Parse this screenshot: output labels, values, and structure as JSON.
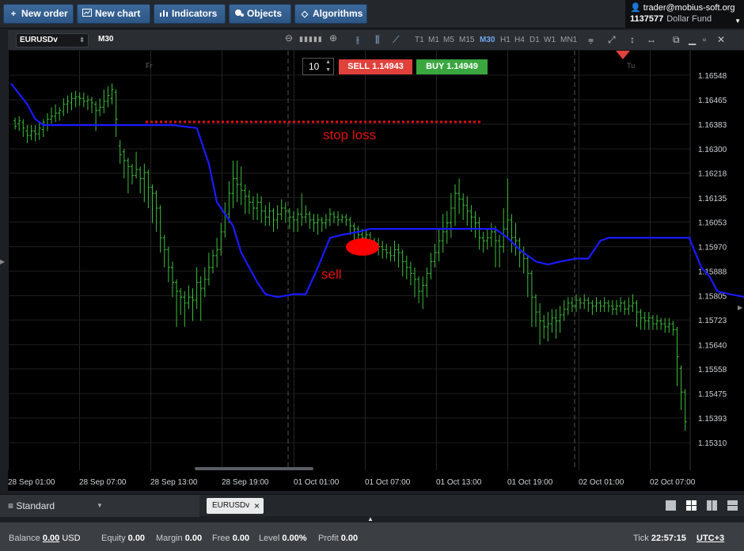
{
  "toolbar": {
    "buttons": [
      {
        "icon": "plus-icon",
        "label": "New order"
      },
      {
        "icon": "chart-icon",
        "label": "New chart"
      },
      {
        "icon": "bar-chart-icon",
        "label": "Indicators"
      },
      {
        "icon": "objects-icon",
        "label": "Objects"
      },
      {
        "icon": "diamond-icon",
        "label": "Algorithms"
      }
    ]
  },
  "account": {
    "user": "trader@mobius-soft.org",
    "number": "1137577",
    "fund": "Dollar Fund"
  },
  "chart_header": {
    "symbol": "EURUSDv",
    "timeframe": "M30",
    "timeframes": [
      "T1",
      "M1",
      "M5",
      "M15",
      "M30",
      "H1",
      "H4",
      "D1",
      "W1",
      "MN1"
    ],
    "active_timeframe": "M30"
  },
  "trade": {
    "quantity": "10",
    "sell_label": "SELL 1.14943",
    "buy_label": "BUY 1.14949",
    "sell_color": "#e0413b",
    "buy_color": "#3aa63f"
  },
  "chart_data": {
    "type": "candlestick",
    "price_axis": [
      "1.16548",
      "1.16465",
      "1.16383",
      "1.16300",
      "1.16218",
      "1.16135",
      "1.16053",
      "1.15970",
      "1.15888",
      "1.15805",
      "1.15723",
      "1.15640",
      "1.15558",
      "1.15475",
      "1.15393",
      "1.15310"
    ],
    "time_axis": [
      "28 Sep 01:00",
      "28 Sep 07:00",
      "28 Sep 13:00",
      "28 Sep 19:00",
      "01 Oct 01:00",
      "01 Oct 07:00",
      "01 Oct 13:00",
      "01 Oct 19:00",
      "02 Oct 01:00",
      "02 Oct 07:00"
    ],
    "session_labels": [
      "Fr",
      "Tu"
    ],
    "candle_color": "#3cbf3c",
    "indicator_color": "#1a1aff",
    "indicator_line": [
      [
        0,
        1.1652
      ],
      [
        4,
        1.1645
      ],
      [
        6,
        1.164
      ],
      [
        8,
        1.1638
      ],
      [
        10,
        1.1638
      ],
      [
        24,
        1.1638
      ],
      [
        40,
        1.1638
      ],
      [
        46,
        1.1637
      ],
      [
        49,
        1.1625
      ],
      [
        51,
        1.1612
      ],
      [
        53,
        1.1608
      ],
      [
        55,
        1.1604
      ],
      [
        57,
        1.1595
      ],
      [
        59,
        1.159
      ],
      [
        61,
        1.1585
      ],
      [
        63,
        1.1581
      ],
      [
        66,
        1.158
      ],
      [
        70,
        1.1581
      ],
      [
        73,
        1.1581
      ],
      [
        76,
        1.159
      ],
      [
        79,
        1.16
      ],
      [
        82,
        1.1601
      ],
      [
        86,
        1.1602
      ],
      [
        89,
        1.1603
      ],
      [
        96,
        1.1603
      ],
      [
        103,
        1.1603
      ],
      [
        120,
        1.1603
      ],
      [
        123,
        1.16
      ],
      [
        126,
        1.1596
      ],
      [
        130,
        1.1592
      ],
      [
        133,
        1.1591
      ],
      [
        136,
        1.1592
      ],
      [
        140,
        1.1593
      ],
      [
        143,
        1.1593
      ],
      [
        146,
        1.1599
      ],
      [
        148,
        1.16
      ],
      [
        154,
        1.16
      ],
      [
        168,
        1.16
      ],
      [
        171,
        1.159
      ],
      [
        173,
        1.1587
      ],
      [
        175,
        1.1582
      ],
      [
        178,
        1.1581
      ],
      [
        182,
        1.158
      ],
      [
        204,
        1.158
      ],
      [
        212,
        1.158
      ],
      [
        216,
        1.1572
      ],
      [
        218,
        1.1564
      ]
    ],
    "candles": [
      [
        1,
        1.16395,
        1.16375,
        1.16405,
        1.16365
      ],
      [
        2,
        1.16385,
        1.16395,
        1.1641,
        1.1636
      ],
      [
        3,
        1.1639,
        1.1637,
        1.164,
        1.1634
      ],
      [
        4,
        1.1636,
        1.16345,
        1.1638,
        1.1632
      ],
      [
        5,
        1.16345,
        1.1636,
        1.1638,
        1.1633
      ],
      [
        6,
        1.1636,
        1.1635,
        1.1638,
        1.16325
      ],
      [
        7,
        1.1635,
        1.1637,
        1.1639,
        1.1633
      ],
      [
        8,
        1.16365,
        1.1639,
        1.164,
        1.1634
      ],
      [
        9,
        1.1638,
        1.164,
        1.1642,
        1.1636
      ],
      [
        10,
        1.164,
        1.1641,
        1.1644,
        1.16385
      ],
      [
        11,
        1.1641,
        1.1642,
        1.1645,
        1.1639
      ],
      [
        12,
        1.1642,
        1.1643,
        1.1644,
        1.16395
      ],
      [
        13,
        1.16425,
        1.1645,
        1.1647,
        1.1641
      ],
      [
        14,
        1.1645,
        1.1646,
        1.1648,
        1.1642
      ],
      [
        15,
        1.16455,
        1.1647,
        1.1649,
        1.1643
      ],
      [
        16,
        1.1647,
        1.16475,
        1.16495,
        1.1644
      ],
      [
        17,
        1.16475,
        1.1647,
        1.1649,
        1.16445
      ],
      [
        18,
        1.1647,
        1.1646,
        1.1649,
        1.1644
      ],
      [
        19,
        1.1646,
        1.16465,
        1.1648,
        1.1643
      ],
      [
        20,
        1.16465,
        1.16455,
        1.16475,
        1.1642
      ],
      [
        21,
        1.1645,
        1.1643,
        1.1646,
        1.1636
      ],
      [
        22,
        1.1643,
        1.1644,
        1.1647,
        1.1641
      ],
      [
        23,
        1.1644,
        1.1646,
        1.165,
        1.1642
      ],
      [
        24,
        1.1646,
        1.1648,
        1.1651,
        1.1644
      ],
      [
        25,
        1.1647,
        1.165,
        1.1652,
        1.1645
      ],
      [
        26,
        1.1649,
        1.164,
        1.165,
        1.1634
      ],
      [
        27,
        1.1631,
        1.1628,
        1.1633,
        1.1625
      ],
      [
        28,
        1.1629,
        1.1626,
        1.163,
        1.162
      ],
      [
        29,
        1.1626,
        1.1624,
        1.1627,
        1.1615
      ],
      [
        30,
        1.1624,
        1.1621,
        1.1625,
        1.1618
      ],
      [
        31,
        1.1621,
        1.1623,
        1.1629,
        1.162
      ],
      [
        32,
        1.1623,
        1.162,
        1.1624,
        1.1615
      ],
      [
        33,
        1.162,
        1.1622,
        1.1625,
        1.1612
      ],
      [
        34,
        1.1622,
        1.1617,
        1.1623,
        1.161
      ],
      [
        35,
        1.1617,
        1.1615,
        1.1618,
        1.1605
      ],
      [
        36,
        1.1615,
        1.161,
        1.1616,
        1.1602
      ],
      [
        37,
        1.161,
        1.16,
        1.1611,
        1.1595
      ],
      [
        38,
        1.16,
        1.1596,
        1.1601,
        1.159
      ],
      [
        39,
        1.1596,
        1.159,
        1.1597,
        1.1585
      ],
      [
        40,
        1.159,
        1.1585,
        1.1592,
        1.158
      ],
      [
        41,
        1.1585,
        1.1582,
        1.1586,
        1.157
      ],
      [
        42,
        1.1582,
        1.158,
        1.1583,
        1.1574
      ],
      [
        43,
        1.158,
        1.1578,
        1.1582,
        1.157
      ],
      [
        44,
        1.1578,
        1.158,
        1.1584,
        1.1576
      ],
      [
        45,
        1.158,
        1.1579,
        1.1583,
        1.1572
      ],
      [
        46,
        1.1579,
        1.1585,
        1.159,
        1.1576
      ],
      [
        47,
        1.1585,
        1.1583,
        1.1587,
        1.1572
      ],
      [
        48,
        1.1583,
        1.1586,
        1.159,
        1.158
      ],
      [
        49,
        1.1586,
        1.159,
        1.1595,
        1.1584
      ],
      [
        50,
        1.159,
        1.1594,
        1.1596,
        1.1588
      ],
      [
        51,
        1.1594,
        1.1596,
        1.16,
        1.159
      ],
      [
        52,
        1.1596,
        1.1602,
        1.1605,
        1.1594
      ],
      [
        53,
        1.1602,
        1.1608,
        1.1612,
        1.16
      ],
      [
        54,
        1.1608,
        1.1615,
        1.1619,
        1.1605
      ],
      [
        55,
        1.1615,
        1.162,
        1.1626,
        1.161
      ],
      [
        56,
        1.162,
        1.1618,
        1.1626,
        1.1612
      ],
      [
        57,
        1.1618,
        1.1616,
        1.1624,
        1.1611
      ],
      [
        58,
        1.1616,
        1.1614,
        1.1618,
        1.1608
      ],
      [
        59,
        1.1614,
        1.1612,
        1.1616,
        1.1608
      ],
      [
        60,
        1.1612,
        1.161,
        1.1614,
        1.1606
      ],
      [
        61,
        1.161,
        1.1612,
        1.1615,
        1.1606
      ],
      [
        62,
        1.1612,
        1.1609,
        1.1614,
        1.1605
      ],
      [
        63,
        1.1609,
        1.1607,
        1.1611,
        1.1604
      ],
      [
        64,
        1.1607,
        1.1609,
        1.1612,
        1.1604
      ],
      [
        65,
        1.1609,
        1.1606,
        1.161,
        1.1602
      ],
      [
        66,
        1.1606,
        1.1608,
        1.1611,
        1.1603
      ],
      [
        67,
        1.1608,
        1.161,
        1.1613,
        1.1606
      ],
      [
        68,
        1.161,
        1.1609,
        1.1612,
        1.1605
      ],
      [
        69,
        1.1609,
        1.1607,
        1.161,
        1.1603
      ],
      [
        70,
        1.1607,
        1.1606,
        1.1609,
        1.1602
      ],
      [
        71,
        1.1606,
        1.1608,
        1.161,
        1.1602
      ],
      [
        72,
        1.1608,
        1.1607,
        1.1615,
        1.1604
      ],
      [
        73,
        1.1607,
        1.1608,
        1.1611,
        1.1605
      ],
      [
        74,
        1.1608,
        1.1606,
        1.1609,
        1.1603
      ],
      [
        75,
        1.1606,
        1.1605,
        1.1608,
        1.1602
      ],
      [
        76,
        1.1605,
        1.1606,
        1.1608,
        1.1601
      ],
      [
        77,
        1.1606,
        1.1605,
        1.1607,
        1.1602
      ],
      [
        78,
        1.1605,
        1.1606,
        1.1608,
        1.1603
      ],
      [
        79,
        1.1606,
        1.1608,
        1.161,
        1.1604
      ],
      [
        80,
        1.1608,
        1.1607,
        1.1609,
        1.1605
      ],
      [
        81,
        1.1607,
        1.1606,
        1.1609,
        1.1604
      ],
      [
        82,
        1.1606,
        1.1607,
        1.1608,
        1.1605
      ],
      [
        83,
        1.1607,
        1.1606,
        1.1608,
        1.1604
      ],
      [
        84,
        1.1606,
        1.1604,
        1.1607,
        1.1601
      ],
      [
        85,
        1.1604,
        1.1603,
        1.1605,
        1.1598
      ],
      [
        86,
        1.1603,
        1.1601,
        1.1604,
        1.1598
      ],
      [
        87,
        1.1601,
        1.16,
        1.1603,
        1.1597
      ],
      [
        88,
        1.16,
        1.1601,
        1.1603,
        1.1598
      ],
      [
        89,
        1.1601,
        1.1599,
        1.1602,
        1.1596
      ],
      [
        90,
        1.1599,
        1.1598,
        1.16,
        1.1595
      ],
      [
        91,
        1.1598,
        1.1597,
        1.16,
        1.1594
      ],
      [
        92,
        1.1597,
        1.1596,
        1.1599,
        1.1593
      ],
      [
        93,
        1.1596,
        1.1595,
        1.1598,
        1.1593
      ],
      [
        94,
        1.1595,
        1.1594,
        1.1597,
        1.1592
      ],
      [
        95,
        1.1594,
        1.1596,
        1.1599,
        1.1592
      ],
      [
        96,
        1.1596,
        1.1595,
        1.1598,
        1.159
      ],
      [
        97,
        1.1595,
        1.1592,
        1.1596,
        1.1587
      ],
      [
        98,
        1.1592,
        1.159,
        1.1594,
        1.1586
      ],
      [
        99,
        1.159,
        1.1588,
        1.1592,
        1.1584
      ],
      [
        100,
        1.1588,
        1.1586,
        1.159,
        1.158
      ],
      [
        101,
        1.1586,
        1.1582,
        1.1587,
        1.1578
      ],
      [
        102,
        1.1582,
        1.1584,
        1.1587,
        1.1576
      ],
      [
        103,
        1.1584,
        1.1588,
        1.159,
        1.158
      ],
      [
        104,
        1.1588,
        1.1592,
        1.1595,
        1.1586
      ],
      [
        105,
        1.1592,
        1.1595,
        1.1598,
        1.159
      ],
      [
        106,
        1.1595,
        1.1599,
        1.1603,
        1.1592
      ],
      [
        107,
        1.1599,
        1.1602,
        1.1608,
        1.1595
      ],
      [
        108,
        1.1602,
        1.1605,
        1.1609,
        1.1598
      ],
      [
        109,
        1.1605,
        1.161,
        1.1615,
        1.16
      ],
      [
        110,
        1.161,
        1.1615,
        1.1618,
        1.1604
      ],
      [
        111,
        1.1615,
        1.1613,
        1.162,
        1.1608
      ],
      [
        112,
        1.1613,
        1.1611,
        1.1615,
        1.1606
      ],
      [
        113,
        1.1611,
        1.1609,
        1.1614,
        1.1604
      ],
      [
        114,
        1.1609,
        1.1607,
        1.1611,
        1.1602
      ],
      [
        115,
        1.1607,
        1.1605,
        1.1609,
        1.16
      ],
      [
        116,
        1.1605,
        1.16,
        1.1607,
        1.1596
      ],
      [
        117,
        1.16,
        1.1599,
        1.1602,
        1.1595
      ],
      [
        118,
        1.1599,
        1.16,
        1.1603,
        1.1596
      ],
      [
        119,
        1.16,
        1.1602,
        1.1605,
        1.1597
      ],
      [
        120,
        1.1602,
        1.1599,
        1.1604,
        1.159
      ],
      [
        121,
        1.1599,
        1.1597,
        1.1601,
        1.159
      ],
      [
        122,
        1.1597,
        1.1603,
        1.161,
        1.1595
      ],
      [
        123,
        1.1603,
        1.1606,
        1.162,
        1.16
      ],
      [
        124,
        1.1606,
        1.16,
        1.1608,
        1.1595
      ],
      [
        125,
        1.16,
        1.1599,
        1.1605,
        1.1594
      ],
      [
        126,
        1.1599,
        1.1595,
        1.16,
        1.159
      ],
      [
        127,
        1.1595,
        1.1593,
        1.1597,
        1.1588
      ],
      [
        128,
        1.1593,
        1.1588,
        1.1594,
        1.158
      ],
      [
        129,
        1.1588,
        1.158,
        1.1589,
        1.157
      ],
      [
        130,
        1.158,
        1.1575,
        1.1581,
        1.157
      ],
      [
        131,
        1.1575,
        1.1572,
        1.1578,
        1.1564
      ],
      [
        132,
        1.1572,
        1.157,
        1.1574,
        1.1566
      ],
      [
        133,
        1.157,
        1.1571,
        1.1575,
        1.1565
      ],
      [
        134,
        1.1571,
        1.1573,
        1.1576,
        1.1568
      ],
      [
        135,
        1.1573,
        1.1572,
        1.1576,
        1.1566
      ],
      [
        136,
        1.1572,
        1.1574,
        1.1577,
        1.1568
      ],
      [
        137,
        1.1574,
        1.1576,
        1.1579,
        1.1572
      ],
      [
        138,
        1.1576,
        1.1578,
        1.158,
        1.1574
      ],
      [
        139,
        1.1578,
        1.1577,
        1.158,
        1.1575
      ],
      [
        140,
        1.1577,
        1.1579,
        1.1581,
        1.1575
      ],
      [
        141,
        1.1579,
        1.1578,
        1.158,
        1.1576
      ],
      [
        142,
        1.1578,
        1.1579,
        1.1581,
        1.1576
      ],
      [
        143,
        1.1579,
        1.1578,
        1.158,
        1.1575
      ],
      [
        144,
        1.1578,
        1.1577,
        1.1579,
        1.1574
      ],
      [
        145,
        1.1577,
        1.1578,
        1.158,
        1.1575
      ],
      [
        146,
        1.1578,
        1.1577,
        1.1579,
        1.1575
      ],
      [
        147,
        1.1577,
        1.1578,
        1.158,
        1.1575
      ],
      [
        148,
        1.1578,
        1.1577,
        1.1579,
        1.1575
      ],
      [
        149,
        1.1577,
        1.1576,
        1.1579,
        1.1574
      ],
      [
        150,
        1.1576,
        1.1577,
        1.1579,
        1.1574
      ],
      [
        151,
        1.1577,
        1.1578,
        1.158,
        1.1575
      ],
      [
        152,
        1.1578,
        1.1576,
        1.1579,
        1.1574
      ],
      [
        153,
        1.1576,
        1.1577,
        1.158,
        1.1574
      ],
      [
        154,
        1.1577,
        1.1578,
        1.1581,
        1.1575
      ],
      [
        155,
        1.1578,
        1.1575,
        1.1579,
        1.157
      ],
      [
        156,
        1.1575,
        1.1573,
        1.1576,
        1.1569
      ],
      [
        157,
        1.1573,
        1.1572,
        1.1575,
        1.1569
      ],
      [
        158,
        1.1572,
        1.1573,
        1.1575,
        1.1569
      ],
      [
        159,
        1.1573,
        1.1571,
        1.1574,
        1.1569
      ],
      [
        160,
        1.1571,
        1.1572,
        1.1574,
        1.1569
      ],
      [
        161,
        1.1572,
        1.1571,
        1.1573,
        1.1569
      ],
      [
        162,
        1.1571,
        1.157,
        1.1573,
        1.1568
      ],
      [
        163,
        1.157,
        1.1571,
        1.1573,
        1.1568
      ],
      [
        164,
        1.1571,
        1.1569,
        1.1572,
        1.1567
      ],
      [
        165,
        1.1569,
        1.156,
        1.157,
        1.155
      ],
      [
        166,
        1.1556,
        1.1548,
        1.1557,
        1.1542
      ],
      [
        167,
        1.1548,
        1.1538,
        1.1549,
        1.1535
      ]
    ]
  },
  "annotations": {
    "stop_loss_label": "stop loss",
    "sell_label": "sell",
    "color": "#e01010"
  },
  "bottom": {
    "workspace": "Standard",
    "chart_tab": "EURUSDv"
  },
  "status": {
    "balance_label": "Balance",
    "balance_value": "0.00",
    "balance_currency": "USD",
    "equity_label": "Equity",
    "equity_value": "0.00",
    "margin_label": "Margin",
    "margin_value": "0.00",
    "free_label": "Free",
    "free_value": "0.00",
    "level_label": "Level",
    "level_value": "0.00%",
    "profit_label": "Profit",
    "profit_value": "0.00",
    "tick_label": "Tick",
    "tick_time": "22:57:15",
    "timezone": "UTC+3"
  }
}
